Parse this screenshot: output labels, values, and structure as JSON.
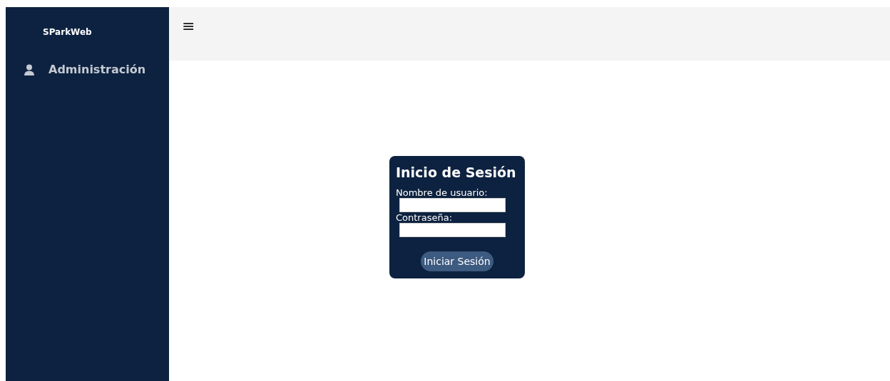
{
  "sidebar": {
    "brand": "SParkWeb",
    "items": [
      {
        "label": "Administración"
      }
    ]
  },
  "topbar": {
    "menu_icon": "≡"
  },
  "login": {
    "title": "Inicio de Sesión",
    "fields": [
      {
        "label": "Nombre de usuario:"
      },
      {
        "label": "Contraseña:"
      }
    ],
    "button": "Iniciar Sesión"
  }
}
